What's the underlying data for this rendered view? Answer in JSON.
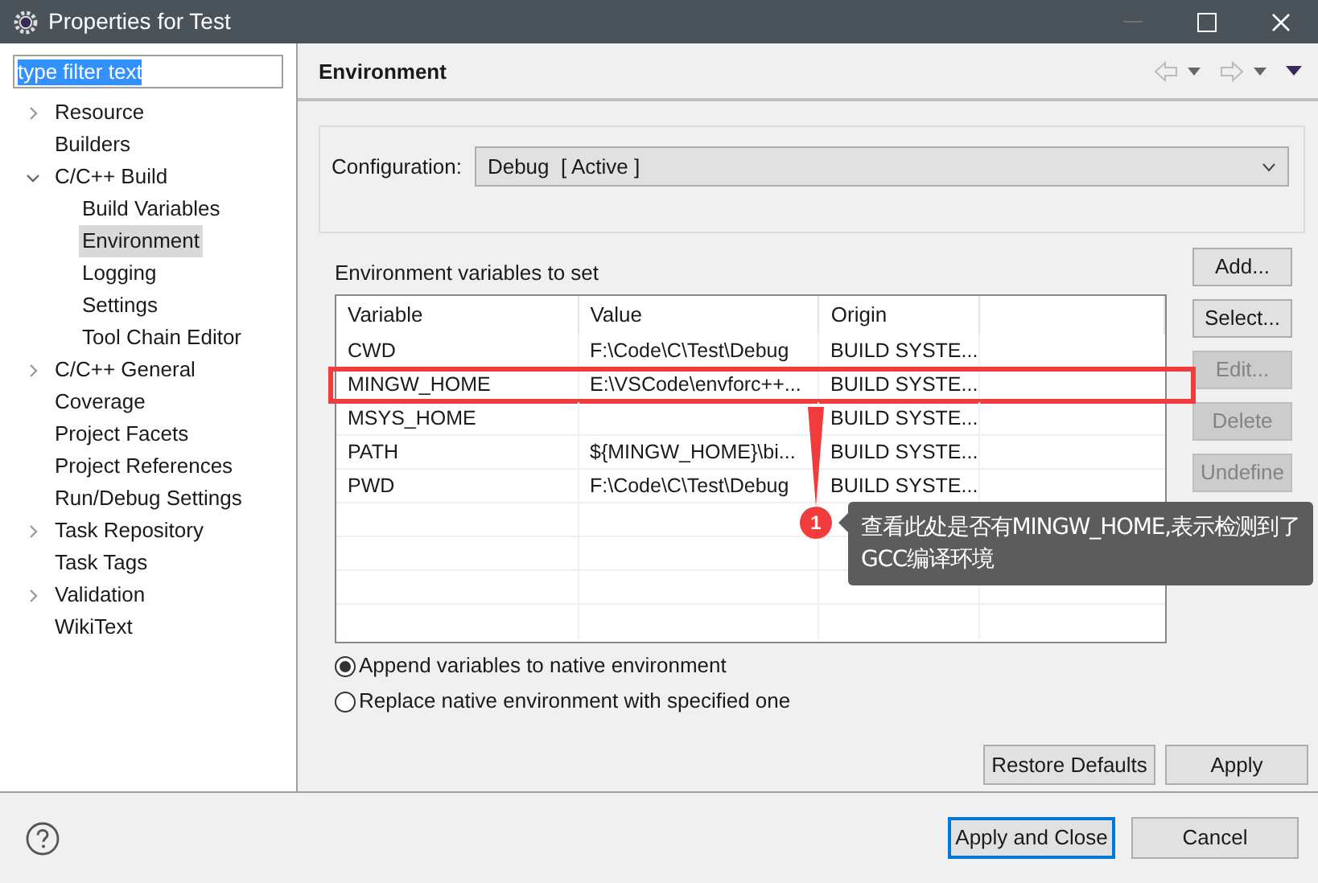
{
  "window": {
    "title": "Properties for Test"
  },
  "filter": {
    "value": "type filter text"
  },
  "tree": [
    {
      "label": "Resource",
      "expanded": false,
      "selected": false
    },
    {
      "label": "Builders",
      "selected": false
    },
    {
      "label": "C/C++ Build",
      "expanded": true,
      "selected": false,
      "children": [
        {
          "label": "Build Variables",
          "selected": false
        },
        {
          "label": "Environment",
          "selected": true
        },
        {
          "label": "Logging",
          "selected": false
        },
        {
          "label": "Settings",
          "selected": false
        },
        {
          "label": "Tool Chain Editor",
          "selected": false
        }
      ]
    },
    {
      "label": "C/C++ General",
      "expanded": false,
      "selected": false
    },
    {
      "label": "Coverage",
      "selected": false
    },
    {
      "label": "Project Facets",
      "selected": false
    },
    {
      "label": "Project References",
      "selected": false
    },
    {
      "label": "Run/Debug Settings",
      "selected": false
    },
    {
      "label": "Task Repository",
      "expanded": false,
      "selected": false
    },
    {
      "label": "Task Tags",
      "selected": false
    },
    {
      "label": "Validation",
      "expanded": false,
      "selected": false
    },
    {
      "label": "WikiText",
      "selected": false
    }
  ],
  "page": {
    "title": "Environment"
  },
  "configuration": {
    "label": "Configuration:",
    "value": "Debug  [ Active ]"
  },
  "table": {
    "caption": "Environment variables to set",
    "columns": [
      "Variable",
      "Value",
      "Origin"
    ],
    "rows": [
      {
        "cells": [
          "CWD",
          "F:\\Code\\C\\Test\\Debug",
          "BUILD SYSTE..."
        ],
        "highlighted": false
      },
      {
        "cells": [
          "MINGW_HOME",
          "E:\\VSCode\\envforc++...",
          "BUILD SYSTE..."
        ],
        "highlighted": true
      },
      {
        "cells": [
          "MSYS_HOME",
          "",
          "BUILD SYSTE..."
        ],
        "highlighted": false
      },
      {
        "cells": [
          "PATH",
          "${MINGW_HOME}\\bi...",
          "BUILD SYSTE..."
        ],
        "highlighted": false
      },
      {
        "cells": [
          "PWD",
          "F:\\Code\\C\\Test\\Debug",
          "BUILD SYSTE..."
        ],
        "highlighted": false
      }
    ]
  },
  "side_buttons": [
    {
      "label": "Add...",
      "disabled": false
    },
    {
      "label": "Select...",
      "disabled": false
    },
    {
      "label": "Edit...",
      "disabled": true
    },
    {
      "label": "Delete",
      "disabled": true
    },
    {
      "label": "Undefine",
      "disabled": true
    }
  ],
  "options": [
    {
      "label": "Append variables to native environment",
      "selected": true
    },
    {
      "label": "Replace native environment with specified one",
      "selected": false
    }
  ],
  "page_buttons": [
    "Restore Defaults",
    "Apply"
  ],
  "dialog_buttons": [
    {
      "label": "Apply and Close",
      "focused": true
    },
    {
      "label": "Cancel",
      "focused": false
    }
  ],
  "annotation": {
    "badge": "1",
    "text": "查看此处是否有MINGW_HOME,表示检测到了GCC编译环境"
  }
}
